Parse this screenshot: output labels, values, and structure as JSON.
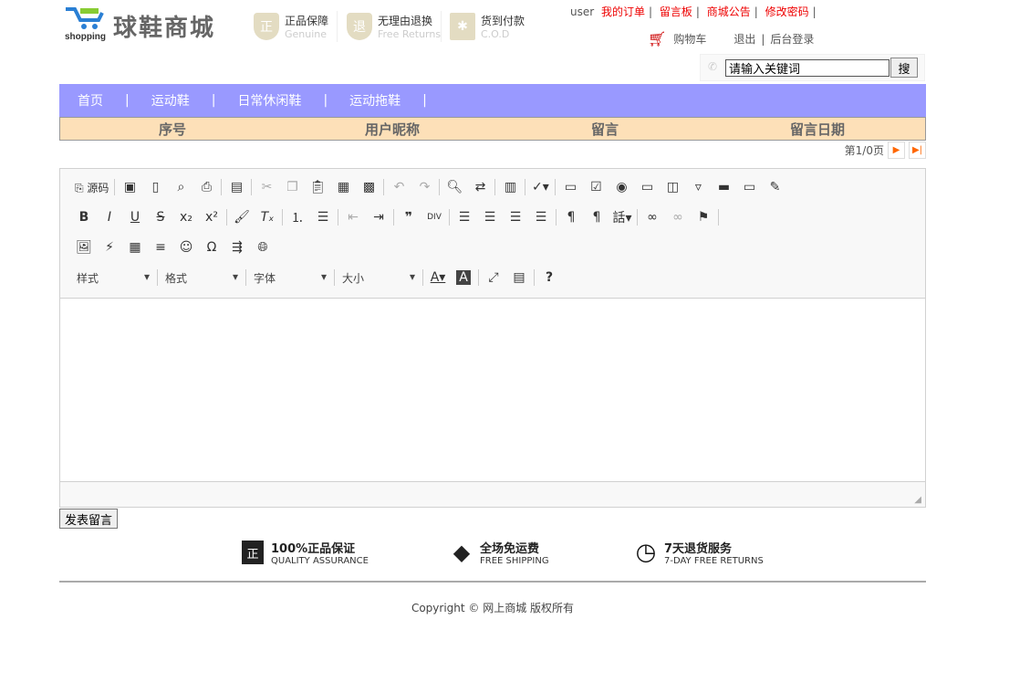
{
  "header": {
    "logo_text": "shopping",
    "brand": "球鞋商城",
    "badges": [
      {
        "icon": "正",
        "title": "正品保障",
        "sub": "Genuine"
      },
      {
        "icon": "退",
        "title": "无理由退换",
        "sub": "Free Returns"
      },
      {
        "icon": "✱",
        "title": "货到付款",
        "sub": "C.O.D"
      }
    ],
    "user": "user",
    "links": [
      "我的订单",
      "留言板",
      "商城公告",
      "修改密码"
    ],
    "cart": "购物车",
    "logout": "退出",
    "admin": "后台登录",
    "search_value": "请输入关键词",
    "search_button": "搜"
  },
  "nav": [
    "首页",
    "运动鞋",
    "日常休闲鞋",
    "运动拖鞋"
  ],
  "table": {
    "headers": [
      "序号",
      "用户昵称",
      "留言",
      "留言日期"
    ]
  },
  "pager": {
    "text": "第1/0页"
  },
  "editor": {
    "source": "源码",
    "combos": [
      "样式",
      "格式",
      "字体",
      "大小"
    ]
  },
  "submit": "发表留言",
  "features": [
    {
      "icon": "正",
      "title": "100%正品保证",
      "sub": "QUALITY ASSURANCE"
    },
    {
      "icon": "◆",
      "title": "全场免运费",
      "sub": "FREE SHIPPING"
    },
    {
      "icon": "◷",
      "title": "7天退货服务",
      "sub": "7-DAY FREE RETURNS"
    }
  ],
  "copyright": "Copyright © 网上商城 版权所有"
}
